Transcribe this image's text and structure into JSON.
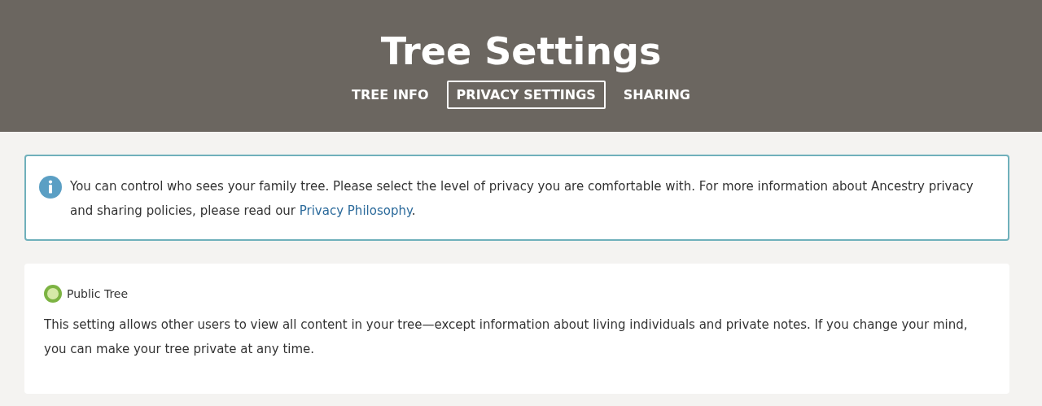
{
  "header": {
    "title": "Tree Settings"
  },
  "tabs": [
    {
      "label": "TREE INFO",
      "selected": false
    },
    {
      "label": "PRIVACY SETTINGS",
      "selected": true
    },
    {
      "label": "SHARING",
      "selected": false
    }
  ],
  "info": {
    "text": "You can control who sees your family tree. Please select the level of privacy you are comfortable with. For more information about Ancestry privacy and sharing policies, please read our ",
    "link": "Privacy Philosophy",
    "after": "."
  },
  "options": [
    {
      "label": "Public Tree",
      "selected": true,
      "description": "This setting allows other users to view all content in your tree—except information about living individuals and private notes. If you change your mind, you can make your tree private at any time."
    }
  ]
}
